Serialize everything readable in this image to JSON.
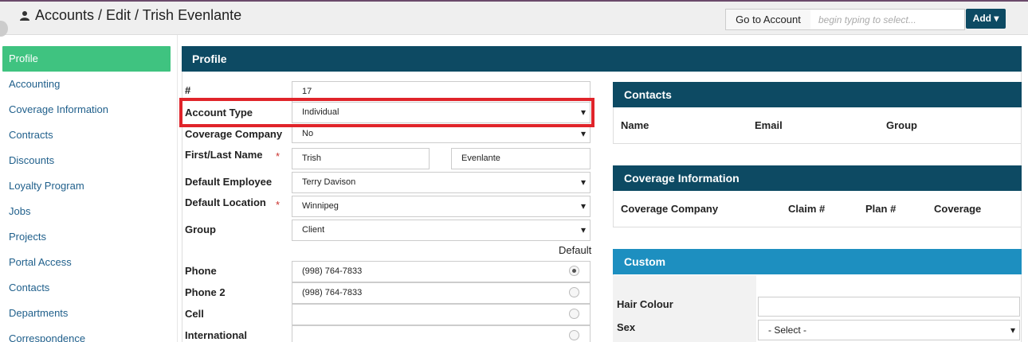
{
  "header": {
    "breadcrumb": "Accounts / Edit / Trish Evenlante",
    "goto_label": "Go to Account",
    "goto_placeholder": "begin typing to select...",
    "add_label": "Add ▾"
  },
  "sidebar": {
    "items": [
      {
        "label": "Profile",
        "active": true
      },
      {
        "label": "Accounting"
      },
      {
        "label": "Coverage Information"
      },
      {
        "label": "Contracts"
      },
      {
        "label": "Discounts"
      },
      {
        "label": "Loyalty Program"
      },
      {
        "label": "Jobs"
      },
      {
        "label": "Projects"
      },
      {
        "label": "Portal Access"
      },
      {
        "label": "Contacts"
      },
      {
        "label": "Departments"
      },
      {
        "label": "Correspondence"
      }
    ]
  },
  "profile": {
    "title": "Profile",
    "number_label": "#",
    "number_value": "17",
    "account_type_label": "Account Type",
    "account_type_value": "Individual",
    "coverage_company_label": "Coverage Company",
    "coverage_company_value": "No",
    "name_label": "First/Last Name",
    "required_mark": "*",
    "first_name": "Trish",
    "last_name": "Evenlante",
    "default_employee_label": "Default Employee",
    "default_employee_value": "Terry Davison",
    "default_location_label": "Default Location",
    "default_location_value": "Winnipeg",
    "group_label": "Group",
    "group_value": "Client",
    "default_column_label": "Default",
    "phone_label": "Phone",
    "phone_value": "(998) 764-7833",
    "phone2_label": "Phone 2",
    "phone2_value": "(998) 764-7833",
    "cell_label": "Cell",
    "cell_value": "",
    "international_label": "International",
    "international_value": ""
  },
  "contacts_card": {
    "title": "Contacts",
    "columns": [
      "Name",
      "Email",
      "Group"
    ]
  },
  "coverage_card": {
    "title": "Coverage Information",
    "columns": [
      "Coverage Company",
      "Claim #",
      "Plan #",
      "Coverage"
    ]
  },
  "custom_card": {
    "title": "Custom",
    "hair_colour_label": "Hair Colour",
    "hair_colour_value": "",
    "sex_label": "Sex",
    "sex_value": "- Select -"
  },
  "colors": {
    "primary": "#0d4a63",
    "active_nav": "#3fc380",
    "custom_header": "#1d8fc0",
    "highlight": "#e0242a",
    "required": "#c9302c"
  }
}
